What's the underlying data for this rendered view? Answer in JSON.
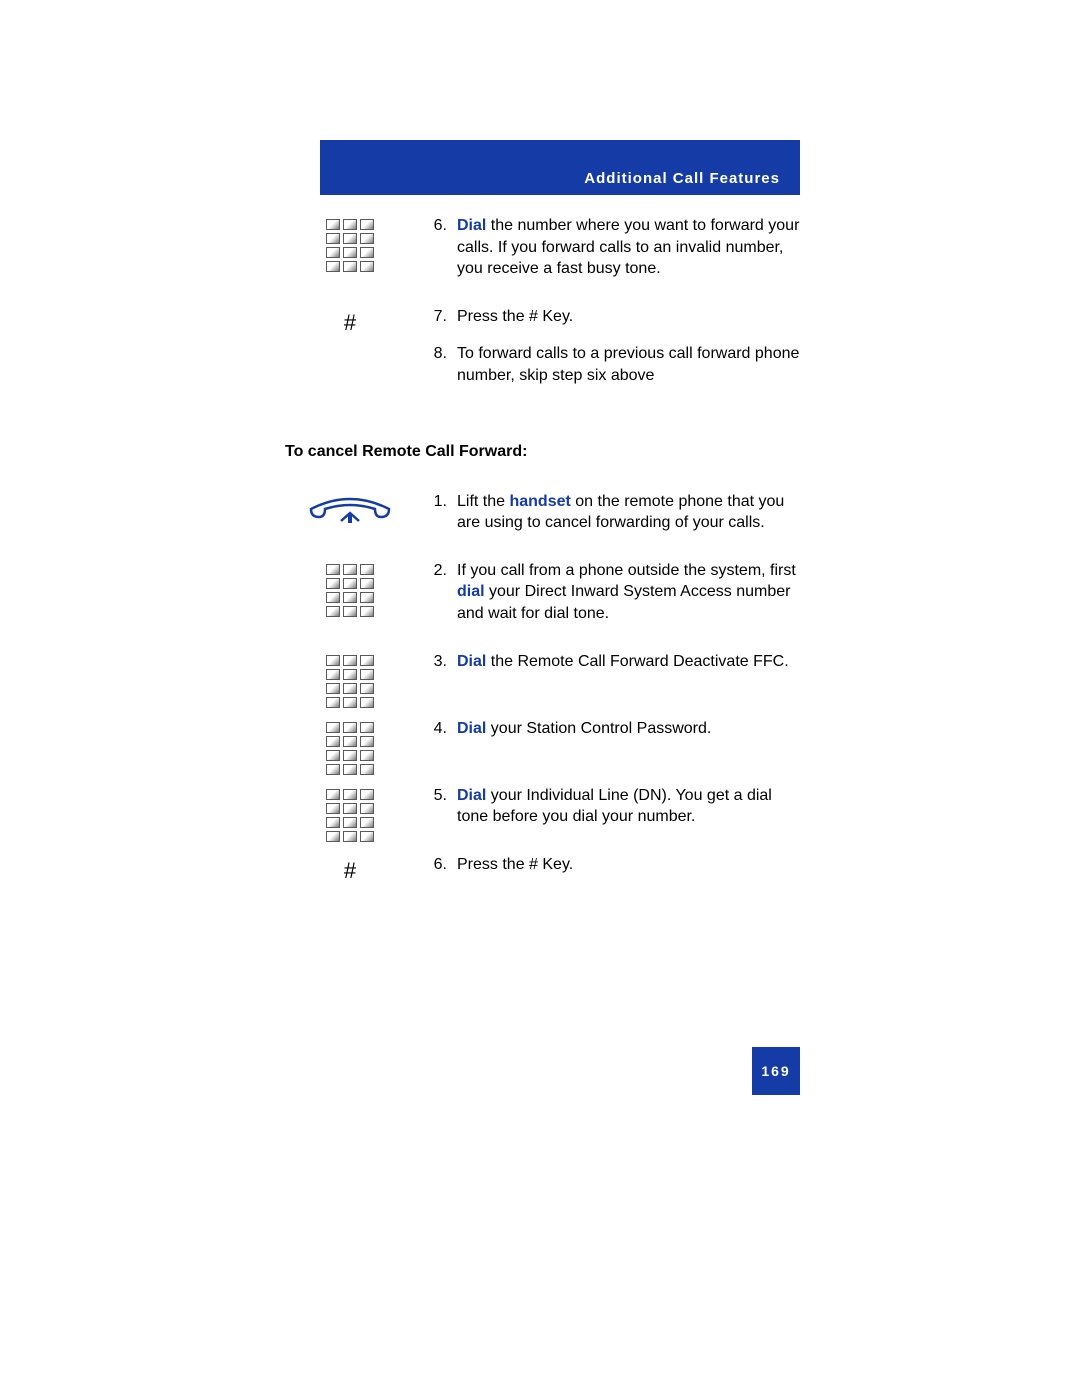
{
  "header": {
    "title": "Additional Call Features"
  },
  "top_steps": [
    {
      "num": "6.",
      "body": {
        "pre": "",
        "bold": "Dial",
        "post": " the number where you want to forward your calls. If you forward calls to an invalid number, you receive a fast busy tone."
      }
    },
    {
      "num": "7.",
      "body": {
        "pre": "Press the # Key.",
        "bold": "",
        "post": ""
      }
    },
    {
      "num": "8.",
      "body": {
        "pre": "To forward calls to a previous call forward phone number, skip step six above",
        "bold": "",
        "post": ""
      }
    }
  ],
  "section_title": "To cancel Remote Call Forward:",
  "cancel_steps": [
    {
      "num": "1.",
      "body": {
        "pre": "Lift the ",
        "bold": "handset",
        "post": " on the remote phone that you are using to cancel forwarding of your calls."
      }
    },
    {
      "num": "2.",
      "body": {
        "pre": "If you call from a phone outside the system, first ",
        "bold": "dial",
        "post": " your Direct Inward System Access number and wait for dial tone."
      }
    },
    {
      "num": "3.",
      "body": {
        "pre": "",
        "bold": "Dial",
        "post": " the Remote Call Forward Deactivate FFC."
      }
    },
    {
      "num": "4.",
      "body": {
        "pre": "",
        "bold": "Dial",
        "post": " your Station Control Password."
      }
    },
    {
      "num": "5.",
      "body": {
        "pre": "",
        "bold": "Dial",
        "post": " your Individual Line (DN). You get a dial tone before you dial your number."
      }
    },
    {
      "num": "6.",
      "body": {
        "pre": "Press the # Key.",
        "bold": "",
        "post": ""
      }
    }
  ],
  "page_number": "169",
  "pound_sign": "#"
}
